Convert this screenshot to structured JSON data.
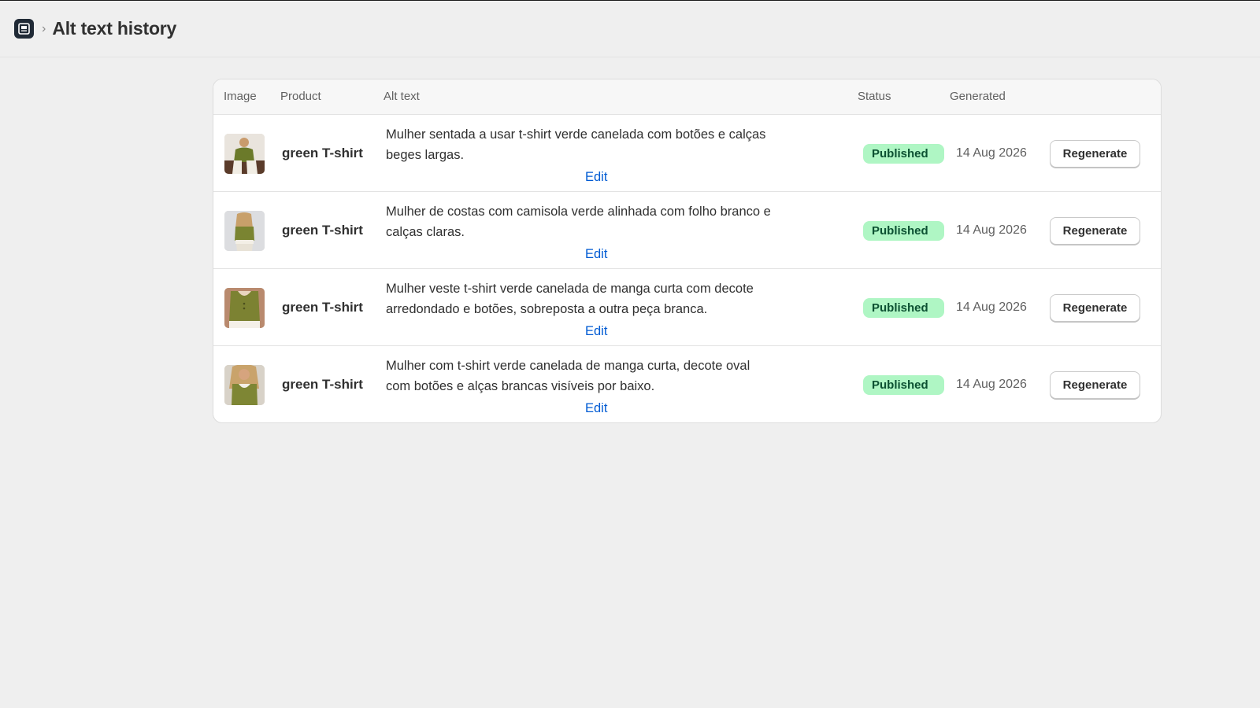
{
  "header": {
    "app_icon": "image-app-icon",
    "separator": "›",
    "title": "Alt text history"
  },
  "table": {
    "columns": {
      "image": "Image",
      "product": "Product",
      "alt_text": "Alt text",
      "status": "Status",
      "generated": "Generated"
    },
    "rows": [
      {
        "product": "green T-shirt",
        "alt_line1": "Mulher sentada a usar t-shirt verde canelada com botões e calças",
        "alt_line2": "beges largas.",
        "edit": "Edit",
        "status": "Published",
        "generated": "14 Aug 2026",
        "action": "Regenerate"
      },
      {
        "product": "green T-shirt",
        "alt_line1": "Mulher de costas com camisola verde alinhada com folho branco e",
        "alt_line2": "calças claras.",
        "edit": "Edit",
        "status": "Published",
        "generated": "14 Aug 2026",
        "action": "Regenerate"
      },
      {
        "product": "green T-shirt",
        "alt_line1": "Mulher veste t-shirt verde canelada de manga curta com decote",
        "alt_line2": "arredondado e botões, sobreposta a outra peça branca.",
        "edit": "Edit",
        "status": "Published",
        "generated": "14 Aug 2026",
        "action": "Regenerate"
      },
      {
        "product": "green T-shirt",
        "alt_line1": "Mulher com t-shirt verde canelada de manga curta, decote oval",
        "alt_line2": "com botões e alças brancas visíveis por baixo.",
        "edit": "Edit",
        "status": "Published",
        "generated": "14 Aug 2026",
        "action": "Regenerate"
      }
    ]
  },
  "colors": {
    "page_bg": "#efefef",
    "badge_bg": "#aff6c4",
    "badge_text": "#0c5132",
    "link": "#005bd3"
  }
}
